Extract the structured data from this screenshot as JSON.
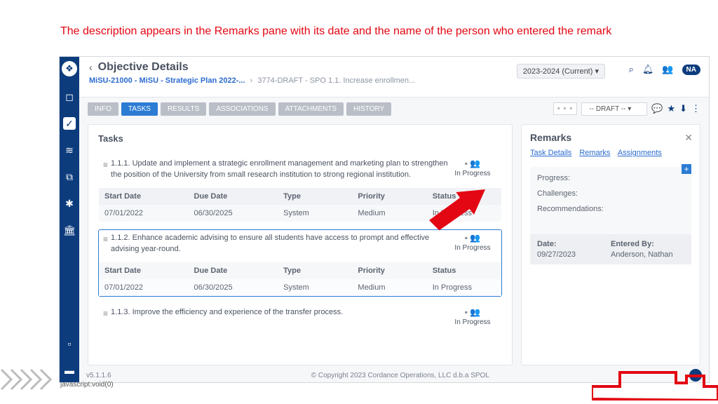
{
  "annotation": "The description appears in the Remarks pane with its date and the name of the person who entered the remark",
  "header": {
    "title": "Objective Details",
    "period": "2023-2024 (Current)",
    "avatar": "NA"
  },
  "breadcrumb": {
    "first": "MiSU-21000 - MiSU - Strategic Plan 2022-...",
    "second": "3774-DRAFT - SPO 1.1. Increase enrollmen..."
  },
  "tabs": {
    "info": "INFO",
    "tasks": "TASKS",
    "results": "RESULTS",
    "associations": "ASSOCIATIONS",
    "attachments": "ATTACHMENTS",
    "history": "HISTORY",
    "status_dropdown": "-- DRAFT --"
  },
  "tasks_card": {
    "title": "Tasks",
    "columns": {
      "start": "Start Date",
      "due": "Due Date",
      "type": "Type",
      "priority": "Priority",
      "status": "Status"
    },
    "items": [
      {
        "num": "1.1.1.",
        "text": "Update and implement a strategic enrollment management and marketing plan to strengthen the position of the University from small research institution to strong regional institution.",
        "status": "In Progress",
        "start": "07/01/2022",
        "due": "06/30/2025",
        "type": "System",
        "priority": "Medium",
        "cellstatus": "In Progress",
        "selected": false
      },
      {
        "num": "1.1.2.",
        "text": "Enhance academic advising to ensure all students have access to prompt and effective advising year-round.",
        "status": "In Progress",
        "start": "07/01/2022",
        "due": "06/30/2025",
        "type": "System",
        "priority": "Medium",
        "cellstatus": "In Progress",
        "selected": true
      },
      {
        "num": "1.1.3.",
        "text": "Improve the efficiency and experience of the transfer process.",
        "status": "In Progress",
        "selected": false
      }
    ]
  },
  "remarks": {
    "title": "Remarks",
    "tabs": {
      "details": "Task Details",
      "remarks": "Remarks",
      "assignments": "Assignments"
    },
    "body": {
      "p": "Progress:",
      "c": "Challenges:",
      "r": "Recommendations:"
    },
    "meta": {
      "date_lbl": "Date:",
      "date": "09/27/2023",
      "by_lbl": "Entered By:",
      "by": "Anderson, Nathan"
    }
  },
  "footer": {
    "version": "v5.1.1.6",
    "copyright": "© Copyright 2023 Cordance Operations, LLC d.b.a SPOL"
  },
  "status_line": "javascript:void(0)"
}
